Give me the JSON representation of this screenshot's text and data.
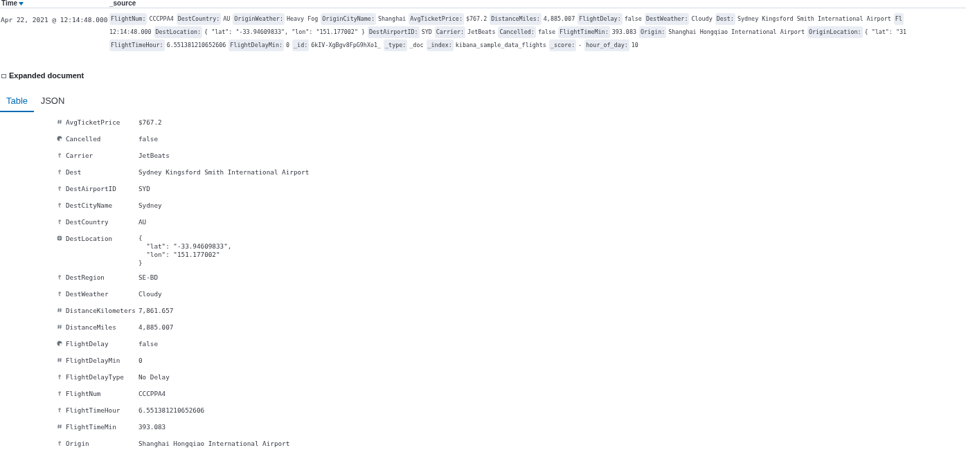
{
  "header": {
    "columns": [
      {
        "label": "Time",
        "sortable": true
      },
      {
        "label": "_source",
        "sortable": false
      }
    ]
  },
  "row": {
    "time": "Apr 22, 2021 @ 12:14:48.000",
    "source_lines": [
      [
        {
          "key": "FlightNum:",
          "value": "CCCPPA4"
        },
        {
          "key": "DestCountry:",
          "value": "AU"
        },
        {
          "key": "OriginWeather:",
          "value": "Heavy Fog"
        },
        {
          "key": "OriginCityName:",
          "value": "Shanghai"
        },
        {
          "key": "AvgTicketPrice:",
          "value": "$767.2"
        },
        {
          "key": "DistanceMiles:",
          "value": "4,885.007"
        },
        {
          "key": "FlightDelay:",
          "value": "false"
        },
        {
          "key": "DestWeather:",
          "value": "Cloudy"
        },
        {
          "key": "Dest:",
          "value": "Sydney Kingsford Smith International Airport"
        },
        {
          "key": "Fl"
        }
      ],
      [
        {
          "value": "12:14:48.000"
        },
        {
          "key": "DestLocation:",
          "value": "{ \"lat\": \"-33.94609833\", \"lon\": \"151.177002\" }"
        },
        {
          "key": "DestAirportID:",
          "value": "SYD"
        },
        {
          "key": "Carrier:",
          "value": "JetBeats"
        },
        {
          "key": "Cancelled:",
          "value": "false"
        },
        {
          "key": "FlightTimeMin:",
          "value": "393.083"
        },
        {
          "key": "Origin:",
          "value": "Shanghai Hongqiao International Airport"
        },
        {
          "key": "OriginLocation:",
          "value": "{ \"lat\": \"31"
        }
      ],
      [
        {
          "key": "FlightTimeHour:",
          "value": "6.551381210652606"
        },
        {
          "key": "FlightDelayMin:",
          "value": "0"
        },
        {
          "key": "_id:",
          "value": "6kIV-XgBgv8FpG9hXo1_"
        },
        {
          "key": "_type:",
          "value": "_doc"
        },
        {
          "key": "_index:",
          "value": "kibana_sample_data_flights"
        },
        {
          "key": "_score:",
          "value": "-"
        },
        {
          "key": "hour_of_day:",
          "value": "10"
        }
      ]
    ]
  },
  "expanded": {
    "title": "Expanded document",
    "tabs": [
      {
        "label": "Table",
        "selected": true
      },
      {
        "label": "JSON",
        "selected": false
      }
    ],
    "fields": [
      {
        "kind": "number",
        "name": "AvgTicketPrice",
        "value": "$767.2"
      },
      {
        "kind": "boolean",
        "name": "Cancelled",
        "value": "false"
      },
      {
        "kind": "string",
        "name": "Carrier",
        "value": "JetBeats"
      },
      {
        "kind": "string",
        "name": "Dest",
        "value": "Sydney Kingsford Smith International Airport"
      },
      {
        "kind": "string",
        "name": "DestAirportID",
        "value": "SYD"
      },
      {
        "kind": "string",
        "name": "DestCityName",
        "value": "Sydney"
      },
      {
        "kind": "string",
        "name": "DestCountry",
        "value": "AU"
      },
      {
        "kind": "geo",
        "name": "DestLocation",
        "value_lines": [
          "{",
          "  \"lat\": \"-33.94609833\",",
          "  \"lon\": \"151.177002\"",
          "}"
        ]
      },
      {
        "kind": "string",
        "name": "DestRegion",
        "value": "SE-BD"
      },
      {
        "kind": "string",
        "name": "DestWeather",
        "value": "Cloudy"
      },
      {
        "kind": "number",
        "name": "DistanceKilometers",
        "value": "7,861.657"
      },
      {
        "kind": "number",
        "name": "DistanceMiles",
        "value": "4,885.007"
      },
      {
        "kind": "boolean",
        "name": "FlightDelay",
        "value": "false"
      },
      {
        "kind": "number",
        "name": "FlightDelayMin",
        "value": "0"
      },
      {
        "kind": "string",
        "name": "FlightDelayType",
        "value": "No Delay"
      },
      {
        "kind": "string",
        "name": "FlightNum",
        "value": "CCCPPA4"
      },
      {
        "kind": "string",
        "name": "FlightTimeHour",
        "value": "6.551381210652606"
      },
      {
        "kind": "number",
        "name": "FlightTimeMin",
        "value": "393.083"
      },
      {
        "kind": "string",
        "name": "Origin",
        "value": "Shanghai Hongqiao International Airport"
      }
    ]
  }
}
